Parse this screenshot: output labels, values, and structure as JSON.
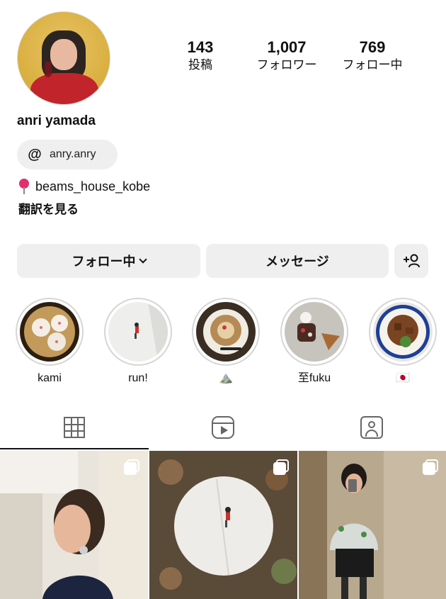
{
  "profile": {
    "display_name": "anri yamada",
    "threads_handle": "anry.anry",
    "location_text": "beams_house_kobe",
    "translate_link": "翻訳を見る"
  },
  "stats": [
    {
      "value": "143",
      "label": "投稿"
    },
    {
      "value": "1,007",
      "label": "フォロワー"
    },
    {
      "value": "769",
      "label": "フォロー中"
    }
  ],
  "actions": {
    "following_label": "フォロー中",
    "message_label": "メッセージ",
    "add_person_icon": "add-person-icon"
  },
  "highlights": [
    {
      "label": "kami"
    },
    {
      "label": "run!"
    },
    {
      "label": "⛰️"
    },
    {
      "label": "至fuku"
    },
    {
      "label": "🇯🇵"
    }
  ],
  "tabs": [
    {
      "icon": "grid-icon"
    },
    {
      "icon": "reels-icon"
    },
    {
      "icon": "tagged-icon"
    }
  ],
  "posts": [
    {
      "type": "carousel"
    },
    {
      "type": "carousel"
    },
    {
      "type": "carousel"
    }
  ],
  "colors": {
    "button_bg": "#efefef",
    "location_pin": "#e1306c"
  }
}
